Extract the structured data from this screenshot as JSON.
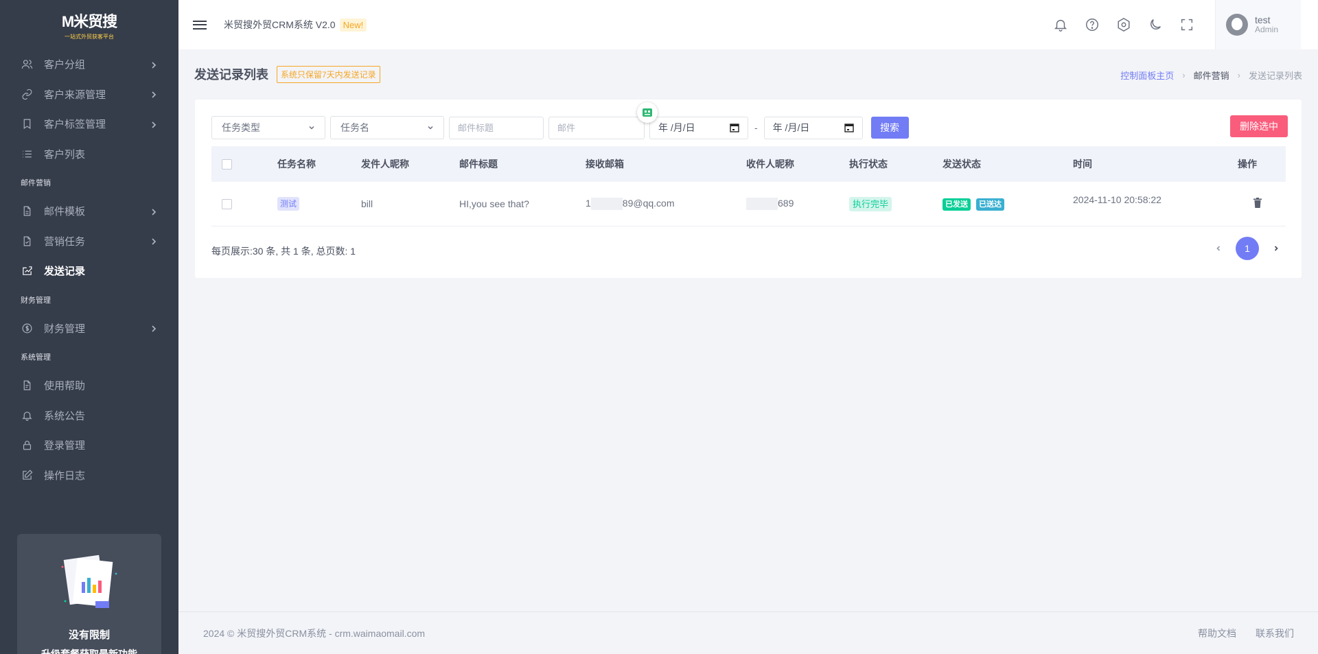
{
  "brand": {
    "logo_text": "M米贸搜",
    "logo_sub": "一站式外贸获客平台"
  },
  "sidebar": {
    "items": [
      {
        "label": "客户分组",
        "icon": "users-icon",
        "has_children": true
      },
      {
        "label": "客户来源管理",
        "icon": "link-icon",
        "has_children": true
      },
      {
        "label": "客户标签管理",
        "icon": "bookmark-icon",
        "has_children": true
      },
      {
        "label": "客户列表",
        "icon": "list-icon",
        "has_children": false
      }
    ],
    "section_mail": "邮件营销",
    "mail_items": [
      {
        "label": "邮件模板",
        "icon": "file-icon",
        "has_children": true
      },
      {
        "label": "营销任务",
        "icon": "task-icon",
        "has_children": true
      },
      {
        "label": "发送记录",
        "icon": "send-record-icon",
        "has_children": false,
        "active": true
      }
    ],
    "section_finance": "财务管理",
    "finance_items": [
      {
        "label": "财务管理",
        "icon": "dollar-icon",
        "has_children": true
      }
    ],
    "section_system": "系统管理",
    "system_items": [
      {
        "label": "使用帮助",
        "icon": "doc-icon",
        "has_children": false
      },
      {
        "label": "系统公告",
        "icon": "bell-icon",
        "has_children": false
      },
      {
        "label": "登录管理",
        "icon": "lock-icon",
        "has_children": false
      },
      {
        "label": "操作日志",
        "icon": "edit-icon",
        "has_children": false
      }
    ],
    "promo": {
      "title": "没有限制",
      "subtitle": "升级套餐获取最新功能"
    }
  },
  "header": {
    "app_title": "米贸搜外贸CRM系统 V2.0",
    "new_badge": "New!",
    "icons": [
      "bell-icon",
      "help-icon",
      "settings-icon",
      "moon-icon",
      "fullscreen-icon"
    ],
    "user": {
      "name": "test",
      "role": "Admin"
    }
  },
  "page": {
    "title": "发送记录列表",
    "retention_note": "系统只保留7天内发送记录",
    "breadcrumb": {
      "home": "控制面板主页",
      "section": "邮件营销",
      "current": "发送记录列表"
    }
  },
  "filters": {
    "task_type": "任务类型",
    "task_name": "任务名",
    "subject_placeholder": "邮件标题",
    "email_placeholder": "邮件",
    "date_start": "年 /月/日",
    "date_end": "年 /月/日",
    "dash": "-",
    "search_label": "搜索",
    "delete_label": "删除选中"
  },
  "table": {
    "columns": [
      "任务名称",
      "发件人昵称",
      "邮件标题",
      "接收邮箱",
      "收件人昵称",
      "执行状态",
      "发送状态",
      "时间",
      "操作"
    ],
    "rows": [
      {
        "task_name": "测试",
        "sender": "bill",
        "subject": "HI,you see that?",
        "email_prefix": "1",
        "email_suffix": "89@qq.com",
        "recipient_suffix": "689",
        "exec_status": "执行完毕",
        "send_status": "已发送",
        "delivery_status": "已送达",
        "time": "2024-11-10 20:58:22"
      }
    ]
  },
  "pagination": {
    "info": "每页展示:30 条, 共 1 条, 总页数: 1",
    "current_page": "1"
  },
  "footer": {
    "copyright": "2024 © 米贸搜外贸CRM系统 - crm.waimaomail.com",
    "help": "帮助文档",
    "contact": "联系我们"
  },
  "colors": {
    "primary": "#727cf5",
    "danger": "#fa5c7c",
    "success": "#0acf97",
    "info": "#39afd1",
    "sidebar_bg": "#353c4a",
    "warning": "#f5a623"
  }
}
